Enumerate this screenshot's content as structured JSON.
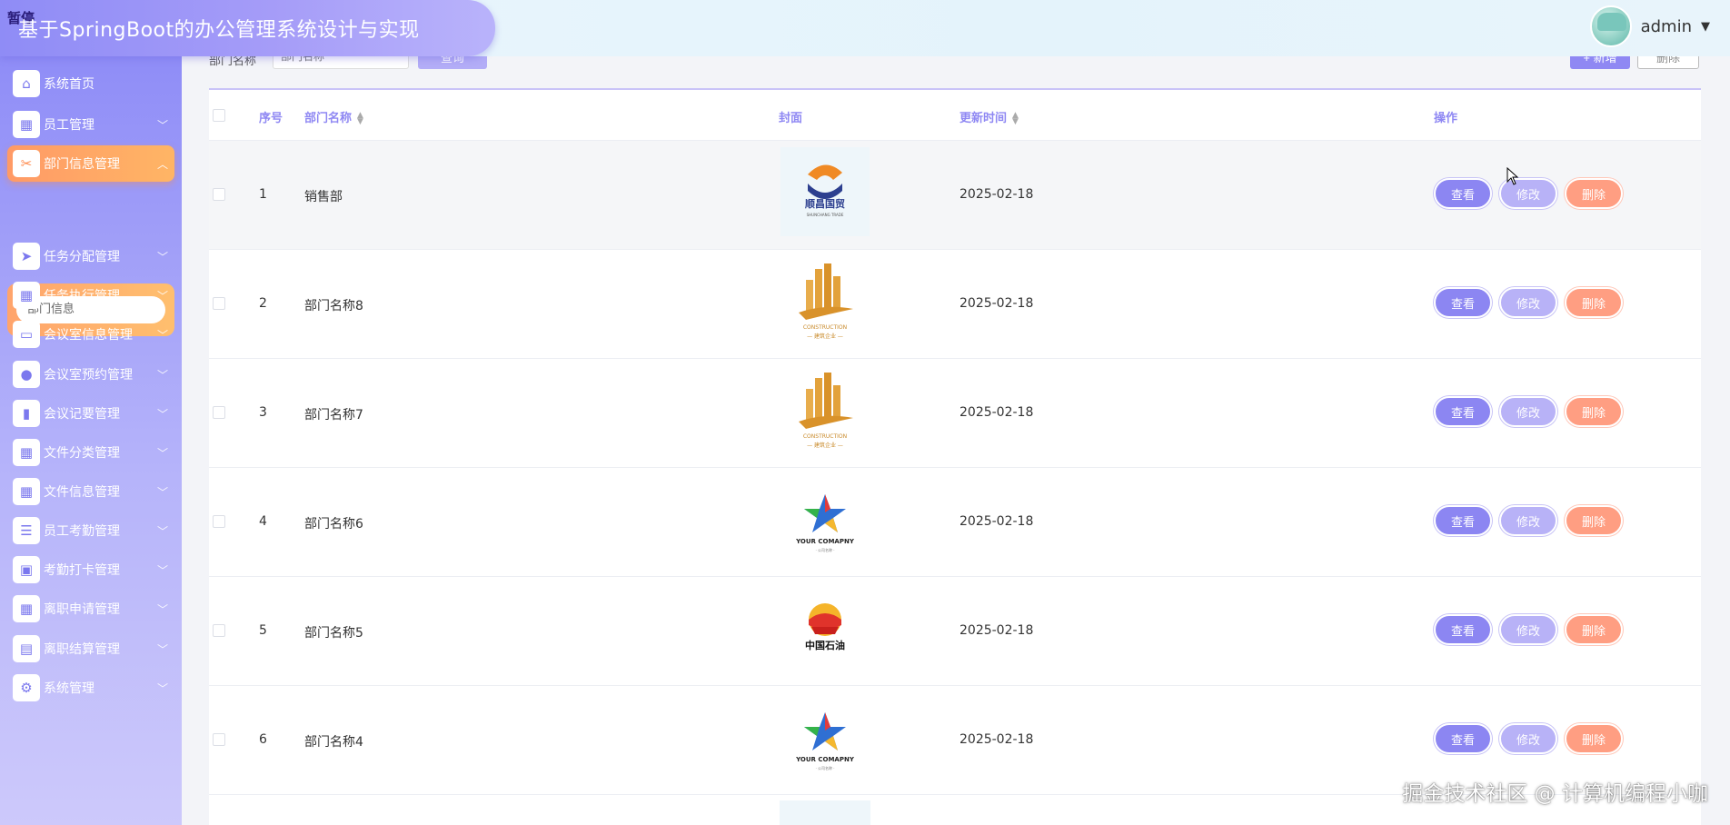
{
  "header": {
    "pause_badge": "暂停",
    "app_title": "基于SpringBoot的办公管理系统设计与实现",
    "username": "admin",
    "caret": "▼"
  },
  "sidebar": {
    "items": [
      {
        "label": "系统首页",
        "icon": "home-icon",
        "glyph": "⌂",
        "expandable": false
      },
      {
        "label": "员工管理",
        "icon": "grid-icon",
        "glyph": "▦",
        "expandable": true
      },
      {
        "label": "部门信息管理",
        "icon": "ticket-icon",
        "glyph": "✂",
        "expandable": true,
        "active": true
      },
      {
        "label": "任务分配管理",
        "icon": "send-icon",
        "glyph": "➤",
        "expandable": true
      },
      {
        "label": "任务执行管理",
        "icon": "grid-icon",
        "glyph": "▦",
        "expandable": true
      },
      {
        "label": "会议室信息管理",
        "icon": "monitor-icon",
        "glyph": "▭",
        "expandable": true
      },
      {
        "label": "会议室预约管理",
        "icon": "user-icon",
        "glyph": "●",
        "expandable": true
      },
      {
        "label": "会议记要管理",
        "icon": "notebook-icon",
        "glyph": "▮",
        "expandable": true
      },
      {
        "label": "文件分类管理",
        "icon": "grid-icon",
        "glyph": "▦",
        "expandable": true
      },
      {
        "label": "文件信息管理",
        "icon": "grid-icon",
        "glyph": "▦",
        "expandable": true
      },
      {
        "label": "员工考勤管理",
        "icon": "list-icon",
        "glyph": "☰",
        "expandable": true
      },
      {
        "label": "考勤打卡管理",
        "icon": "clipboard-icon",
        "glyph": "▣",
        "expandable": true
      },
      {
        "label": "离职申请管理",
        "icon": "grid-icon",
        "glyph": "▦",
        "expandable": true
      },
      {
        "label": "离职结算管理",
        "icon": "wallet-icon",
        "glyph": "▤",
        "expandable": true
      },
      {
        "label": "系统管理",
        "icon": "gear-icon",
        "glyph": "⚙",
        "expandable": true
      }
    ],
    "sub_items": [
      "部门信息"
    ]
  },
  "search": {
    "label": "部门名称",
    "placeholder": "部门名称",
    "search_button": "查询",
    "add_button": "+ 新增",
    "delete_button": "删除"
  },
  "table": {
    "headers": {
      "index": "序号",
      "name": "部门名称",
      "cover": "封面",
      "updated": "更新时间",
      "actions": "操作"
    },
    "rows": [
      {
        "index": "1",
        "name": "销售部",
        "logo": "trade-logo",
        "updated": "2025-02-18"
      },
      {
        "index": "2",
        "name": "部门名称8",
        "logo": "construction-logo",
        "updated": "2025-02-18"
      },
      {
        "index": "3",
        "name": "部门名称7",
        "logo": "construction-logo",
        "updated": "2025-02-18"
      },
      {
        "index": "4",
        "name": "部门名称6",
        "logo": "star-logo",
        "updated": "2025-02-18"
      },
      {
        "index": "5",
        "name": "部门名称5",
        "logo": "petro-logo",
        "updated": "2025-02-18"
      },
      {
        "index": "6",
        "name": "部门名称4",
        "logo": "star-logo",
        "updated": "2025-02-18"
      }
    ],
    "action_labels": {
      "view": "查看",
      "edit": "修改",
      "delete": "删除"
    }
  },
  "logos": {
    "trade": {
      "text": "顺昌国贸",
      "sub": "SHUNCHANG TRADE"
    },
    "construction": {
      "text": "CONSTRUCTION",
      "sub": "— 建筑企业 —"
    },
    "star": {
      "text": "YOUR COMAPNY",
      "sub": "· 公司名称 ·"
    },
    "petro": {
      "text": "中国石油"
    }
  },
  "watermark": "掘金技术社区 @ 计算机编程小咖",
  "colors": {
    "accent": "#8f88f3",
    "active_menu": "#ff9a66",
    "delete_button": "#ff9e82"
  }
}
